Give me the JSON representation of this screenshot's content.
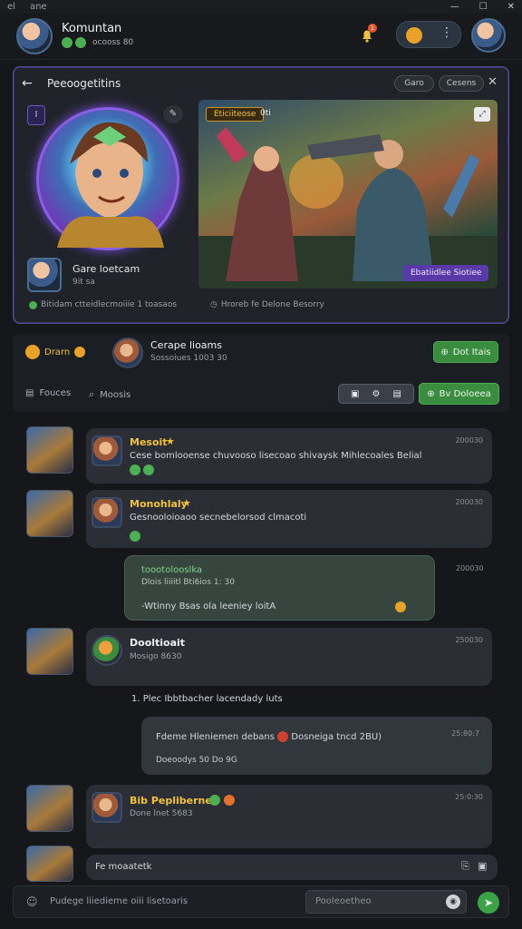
{
  "window": {
    "menu_left": "el",
    "menu_mid": "ane"
  },
  "header": {
    "title": "Komuntan",
    "subtitle": "ocooss 80",
    "notif_count": "1"
  },
  "panel": {
    "title": "Peeoogetitins",
    "chip_game": "Garo",
    "chip_cases": "Cesens",
    "scene_tag": "Eticiiteose",
    "scene_tag2": "0ti",
    "scene_badge": "Ebatiidlee Siotiee",
    "player_name": "Gare loetcam",
    "player_sub": "9it sa",
    "stat_left": "Bitidam ctteidlecmoiiie 1 toasaos",
    "stat_right": "Hroreb fe Delone Besorry"
  },
  "section": {
    "badge_label": "Drarn",
    "team_name": "Cerape lioams",
    "team_meta": "Sossoiues   1003 30",
    "join_label": "Dot Itais",
    "filter_label": "Fouces",
    "search_label": "Moosis",
    "action_label": "Bv Doloeea"
  },
  "messages": [
    {
      "name": "Mesoit",
      "text": "Cese bomlooense chuvooso lisecoao shivaysk   Mihlecoales Belial",
      "time": "200030"
    },
    {
      "name": "Monohlaly",
      "text": "Gesnooloioaoo secnebelorsod clmacoti",
      "time": "200030"
    },
    {
      "name": "toootolooslka",
      "sub": "Dlois liiiitl Bti6ios 1: 30",
      "text": "-Wtinny Bsas ola leeniey loitA",
      "time": "200030"
    },
    {
      "name": "Dooltioait",
      "sub": "Mosigo 8630",
      "text": "1. Plec Ibbtbacher lacendady luts",
      "time": "250030"
    },
    {
      "name": "Fdeme Hleniemen debans",
      "text": "Dosneiga tncd 2BU)",
      "sub": "Doeoodys   50   Do   9G",
      "time": "25:80:7"
    },
    {
      "name": "Bib Pepliberne",
      "sub": "Done lnet 5683",
      "time": "25:0:30"
    },
    {
      "name": "Fe moaatetk",
      "time": ""
    }
  ],
  "composer": {
    "left_text": "Pudege liiedieme oiii lisetoaris",
    "placeholder": "Pooleoetheo"
  },
  "colors": {
    "accent": "#8b5ee6",
    "green": "#3a8d3f",
    "gold": "#f0c23a"
  }
}
